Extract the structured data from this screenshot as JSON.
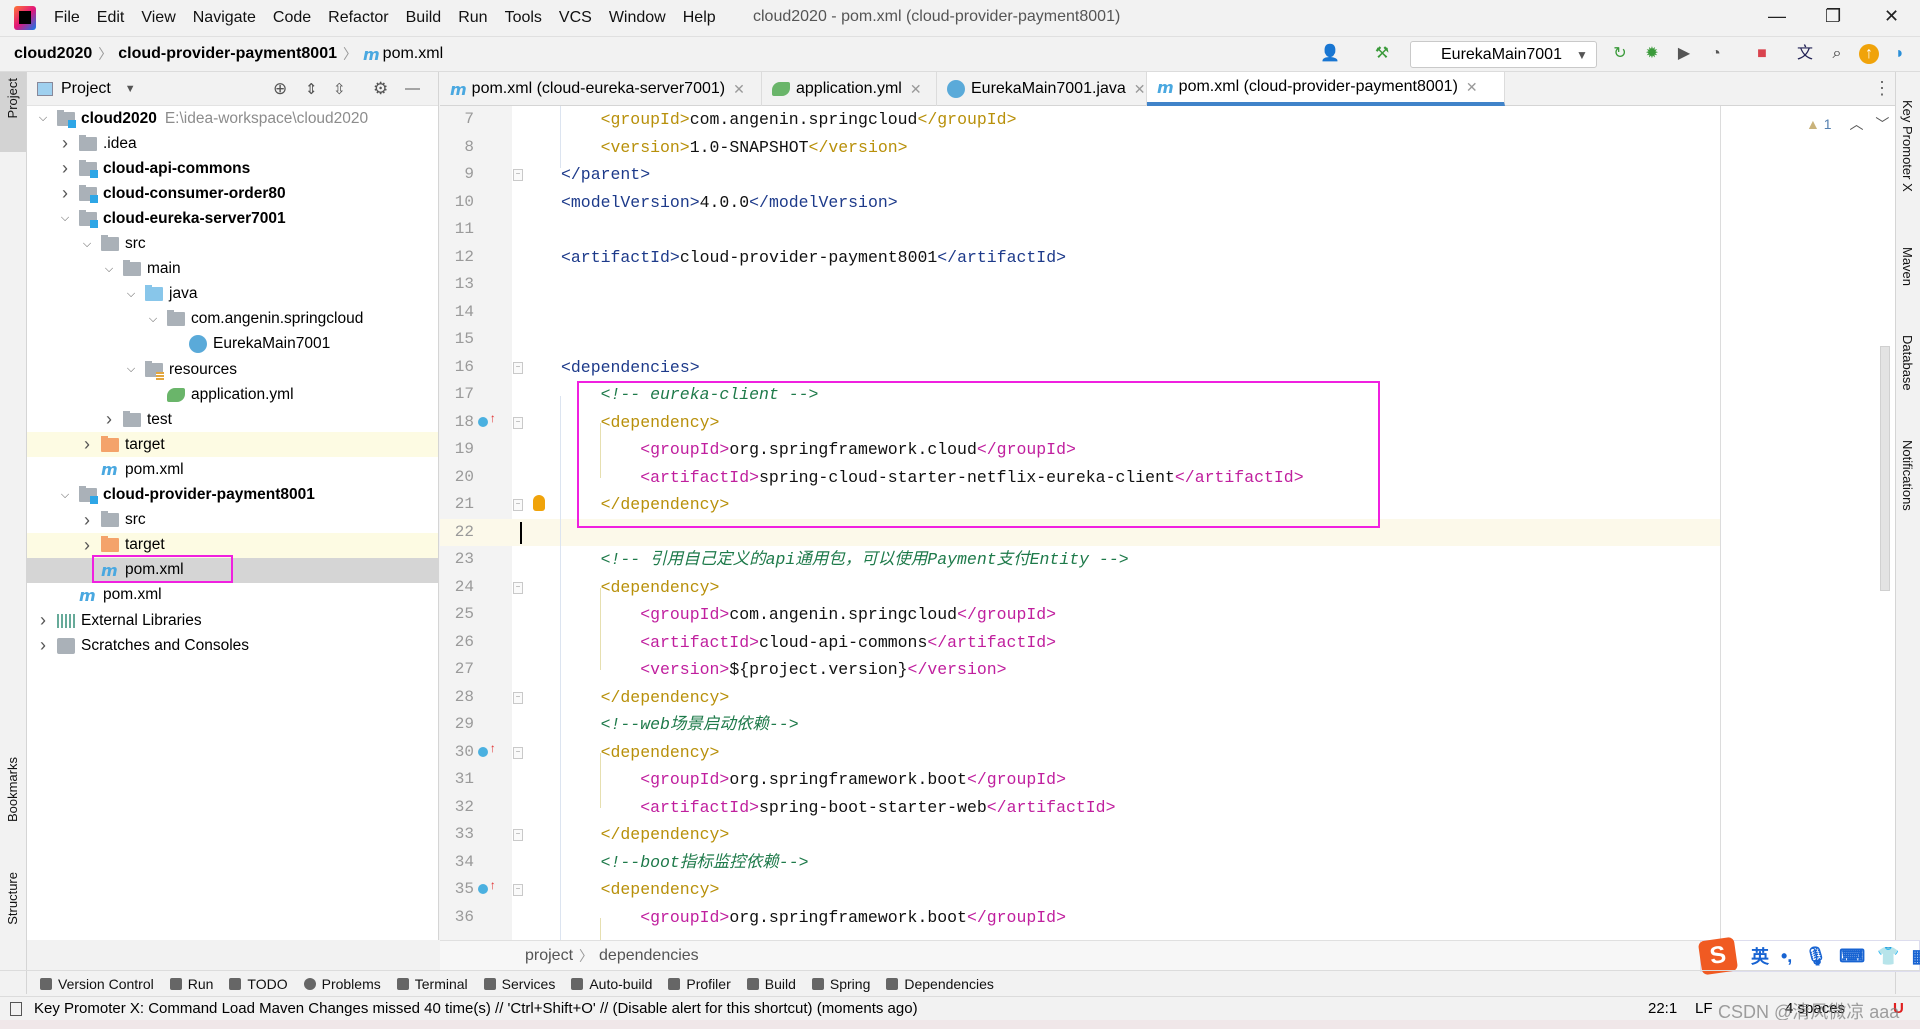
{
  "menubar": {
    "items": [
      "File",
      "Edit",
      "View",
      "Navigate",
      "Code",
      "Refactor",
      "Build",
      "Run",
      "Tools",
      "VCS",
      "Window",
      "Help"
    ],
    "window_title": "cloud2020 - pom.xml (cloud-provider-payment8001)"
  },
  "navbar": {
    "crumbs": [
      "cloud2020",
      "cloud-provider-payment8001",
      "pom.xml"
    ],
    "run_config": "EurekaMain7001"
  },
  "left_stripe": {
    "project": "Project",
    "bookmarks": "Bookmarks",
    "structure": "Structure"
  },
  "right_stripe": {
    "key_promoter": "Key Promoter X",
    "maven": "Maven",
    "database": "Database",
    "notifications": "Notifications"
  },
  "project_panel": {
    "title": "Project",
    "tree": [
      {
        "level": 0,
        "arrow": "open",
        "icon": "module",
        "label": "cloud2020",
        "bold": true,
        "hint": "E:\\idea-workspace\\cloud2020"
      },
      {
        "level": 1,
        "arrow": "closed",
        "icon": "folder",
        "label": ".idea"
      },
      {
        "level": 1,
        "arrow": "closed",
        "icon": "module",
        "label": "cloud-api-commons",
        "bold": true
      },
      {
        "level": 1,
        "arrow": "closed",
        "icon": "module",
        "label": "cloud-consumer-order80",
        "bold": true
      },
      {
        "level": 1,
        "arrow": "open",
        "icon": "module",
        "label": "cloud-eureka-server7001",
        "bold": true
      },
      {
        "level": 2,
        "arrow": "open",
        "icon": "folder",
        "label": "src"
      },
      {
        "level": 3,
        "arrow": "open",
        "icon": "folder",
        "label": "main"
      },
      {
        "level": 4,
        "arrow": "open",
        "icon": "folder-blue",
        "label": "java"
      },
      {
        "level": 5,
        "arrow": "open",
        "icon": "package",
        "label": "com.angenin.springcloud"
      },
      {
        "level": 6,
        "arrow": "none",
        "icon": "spring-class",
        "label": "EurekaMain7001"
      },
      {
        "level": 4,
        "arrow": "open",
        "icon": "resources",
        "label": "resources"
      },
      {
        "level": 5,
        "arrow": "none",
        "icon": "yml",
        "label": "application.yml"
      },
      {
        "level": 3,
        "arrow": "closed",
        "icon": "folder",
        "label": "test"
      },
      {
        "level": 2,
        "arrow": "closed",
        "icon": "folder-orange",
        "label": "target",
        "highlight": true
      },
      {
        "level": 2,
        "arrow": "none",
        "icon": "maven",
        "label": "pom.xml"
      },
      {
        "level": 1,
        "arrow": "open",
        "icon": "module",
        "label": "cloud-provider-payment8001",
        "bold": true
      },
      {
        "level": 2,
        "arrow": "closed",
        "icon": "folder",
        "label": "src"
      },
      {
        "level": 2,
        "arrow": "closed",
        "icon": "folder-orange",
        "label": "target",
        "highlight": true
      },
      {
        "level": 2,
        "arrow": "none",
        "icon": "maven",
        "label": "pom.xml",
        "selected": true
      },
      {
        "level": 1,
        "arrow": "none",
        "icon": "maven",
        "label": "pom.xml"
      },
      {
        "level": 0,
        "arrow": "closed",
        "icon": "libraries",
        "label": "External Libraries"
      },
      {
        "level": 0,
        "arrow": "closed",
        "icon": "scratches",
        "label": "Scratches and Consoles"
      }
    ]
  },
  "tabs": [
    {
      "icon": "maven",
      "label": "pom.xml (cloud-eureka-server7001)"
    },
    {
      "icon": "yml",
      "label": "application.yml"
    },
    {
      "icon": "spring-class",
      "label": "EurekaMain7001.java"
    },
    {
      "icon": "maven",
      "label": "pom.xml (cloud-provider-payment8001)",
      "active": true
    }
  ],
  "editor": {
    "warnings": "1",
    "caret_line": 22,
    "lines": [
      {
        "n": 7,
        "indent": 1,
        "tokens": [
          [
            "yel",
            "<groupId>"
          ],
          [
            "txt",
            "com.angenin.springcloud"
          ],
          [
            "yel",
            "</groupId>"
          ]
        ]
      },
      {
        "n": 8,
        "indent": 1,
        "tokens": [
          [
            "yel",
            "<version>"
          ],
          [
            "txt",
            "1.0-SNAPSHOT"
          ],
          [
            "yel",
            "</version>"
          ]
        ]
      },
      {
        "n": 9,
        "indent": 0,
        "fold": true,
        "tokens": [
          [
            "navy",
            "</parent>"
          ]
        ]
      },
      {
        "n": 10,
        "indent": 0,
        "tokens": [
          [
            "navy",
            "<modelVersion>"
          ],
          [
            "txt",
            "4.0.0"
          ],
          [
            "navy",
            "</modelVersion>"
          ]
        ]
      },
      {
        "n": 11,
        "indent": 0,
        "tokens": []
      },
      {
        "n": 12,
        "indent": 0,
        "tokens": [
          [
            "navy",
            "<artifactId>"
          ],
          [
            "txt",
            "cloud-provider-payment8001"
          ],
          [
            "navy",
            "</artifactId>"
          ]
        ]
      },
      {
        "n": 13,
        "indent": 0,
        "tokens": []
      },
      {
        "n": 14,
        "indent": 0,
        "tokens": []
      },
      {
        "n": 15,
        "indent": 0,
        "tokens": []
      },
      {
        "n": 16,
        "indent": 0,
        "fold": true,
        "tokens": [
          [
            "navy",
            "<dependencies>"
          ]
        ]
      },
      {
        "n": 17,
        "indent": 1,
        "tokens": [
          [
            "com",
            "<!-- eureka-client -->"
          ]
        ]
      },
      {
        "n": 18,
        "indent": 1,
        "fold": true,
        "override": true,
        "tokens": [
          [
            "yel",
            "<dependency>"
          ]
        ]
      },
      {
        "n": 19,
        "indent": 2,
        "tokens": [
          [
            "mag",
            "<groupId>"
          ],
          [
            "txt",
            "org.springframework.cloud"
          ],
          [
            "mag",
            "</groupId>"
          ]
        ]
      },
      {
        "n": 20,
        "indent": 2,
        "tokens": [
          [
            "mag",
            "<artifactId>"
          ],
          [
            "txt",
            "spring-cloud-starter-netflix-eureka-client"
          ],
          [
            "mag",
            "</artifactId>"
          ]
        ]
      },
      {
        "n": 21,
        "indent": 1,
        "fold": true,
        "bulb": true,
        "tokens": [
          [
            "yel",
            "</dependency>"
          ]
        ]
      },
      {
        "n": 22,
        "indent": 0,
        "tokens": []
      },
      {
        "n": 23,
        "indent": 1,
        "tokens": [
          [
            "com",
            "<!-- 引用自己定义的api通用包，可以使用Payment支付Entity -->"
          ]
        ]
      },
      {
        "n": 24,
        "indent": 1,
        "fold": true,
        "tokens": [
          [
            "yel",
            "<dependency>"
          ]
        ]
      },
      {
        "n": 25,
        "indent": 2,
        "tokens": [
          [
            "mag",
            "<groupId>"
          ],
          [
            "txt",
            "com.angenin.springcloud"
          ],
          [
            "mag",
            "</groupId>"
          ]
        ]
      },
      {
        "n": 26,
        "indent": 2,
        "tokens": [
          [
            "mag",
            "<artifactId>"
          ],
          [
            "txt",
            "cloud-api-commons"
          ],
          [
            "mag",
            "</artifactId>"
          ]
        ]
      },
      {
        "n": 27,
        "indent": 2,
        "tokens": [
          [
            "mag",
            "<version>"
          ],
          [
            "txt",
            "${project.version}"
          ],
          [
            "mag",
            "</version>"
          ]
        ]
      },
      {
        "n": 28,
        "indent": 1,
        "fold": true,
        "tokens": [
          [
            "yel",
            "</dependency>"
          ]
        ]
      },
      {
        "n": 29,
        "indent": 1,
        "tokens": [
          [
            "com",
            "<!--web场景启动依赖-->"
          ]
        ]
      },
      {
        "n": 30,
        "indent": 1,
        "fold": true,
        "override": true,
        "tokens": [
          [
            "yel",
            "<dependency>"
          ]
        ]
      },
      {
        "n": 31,
        "indent": 2,
        "tokens": [
          [
            "mag",
            "<groupId>"
          ],
          [
            "txt",
            "org.springframework.boot"
          ],
          [
            "mag",
            "</groupId>"
          ]
        ]
      },
      {
        "n": 32,
        "indent": 2,
        "tokens": [
          [
            "mag",
            "<artifactId>"
          ],
          [
            "txt",
            "spring-boot-starter-web"
          ],
          [
            "mag",
            "</artifactId>"
          ]
        ]
      },
      {
        "n": 33,
        "indent": 1,
        "fold": true,
        "tokens": [
          [
            "yel",
            "</dependency>"
          ]
        ]
      },
      {
        "n": 34,
        "indent": 1,
        "tokens": [
          [
            "com",
            "<!--boot指标监控依赖-->"
          ]
        ]
      },
      {
        "n": 35,
        "indent": 1,
        "fold": true,
        "override": true,
        "tokens": [
          [
            "yel",
            "<dependency>"
          ]
        ]
      },
      {
        "n": 36,
        "indent": 2,
        "tokens": [
          [
            "mag",
            "<groupId>"
          ],
          [
            "txt",
            "org.springframework.boot"
          ],
          [
            "mag",
            "</groupId>"
          ]
        ]
      }
    ]
  },
  "breadcrumb": [
    "project",
    "dependencies"
  ],
  "toolwindows": [
    "Version Control",
    "Run",
    "TODO",
    "Problems",
    "Terminal",
    "Services",
    "Auto-build",
    "Profiler",
    "Build",
    "Spring",
    "Dependencies"
  ],
  "status": {
    "message": "Key Promoter X: Command Load Maven Changes missed 40 time(s) // 'Ctrl+Shift+O' // (Disable alert for this shortcut) (moments ago)",
    "position": "22:1",
    "line_sep": "LF",
    "indent": "4 spaces"
  },
  "ime": {
    "logo": "S",
    "mode": "英"
  },
  "watermark": "CSDN @清风微凉 aaa",
  "colors": {
    "highlight_box": "#f020e0",
    "active_tab": "#4083c9",
    "tag_navy": "#1d3a8a",
    "tag_yellow": "#b8900a",
    "tag_magenta": "#c01f9e",
    "comment": "#1e7a4a"
  }
}
